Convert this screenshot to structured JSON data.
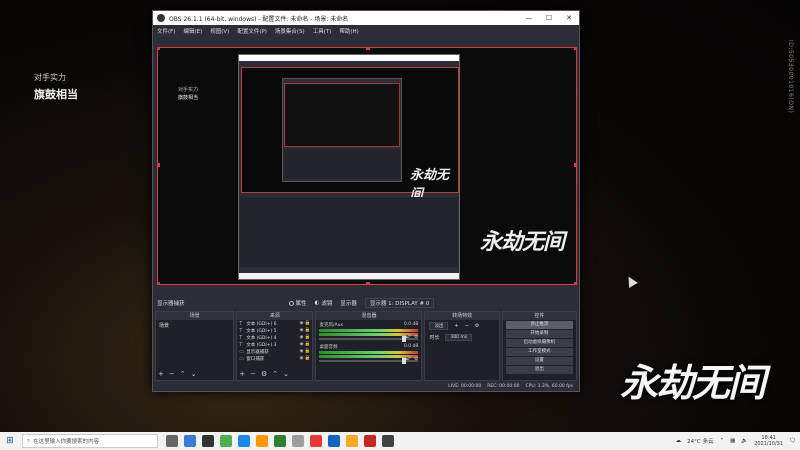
{
  "overlay": {
    "opponent_label": "对手实力",
    "opponent_value": "旗鼓相当",
    "side_id": "ID:50530001016(ON)",
    "logo": "永劫无间"
  },
  "obs": {
    "title": "OBS 26.1.1 (64-bit, windows) - 配置文件: 未命名 - 场景: 未命名",
    "menus": [
      "文件(F)",
      "编辑(E)",
      "视图(V)",
      "配置文件(P)",
      "场景集合(S)",
      "工具(T)",
      "帮助(H)"
    ],
    "preview_text1": "对手实力",
    "preview_text2": "旗鼓相当",
    "scene_selector": "显示器捕获",
    "scenebar_items": [
      "属性",
      "滤镜",
      "显示器",
      "显示器 1: DISPLAY # 0"
    ],
    "docks": {
      "scenes": {
        "title": "场景",
        "items": [
          "场景"
        ]
      },
      "sources": {
        "title": "来源",
        "items": [
          {
            "icon": "T",
            "label": "文本 (GDI+) 6"
          },
          {
            "icon": "T",
            "label": "文本 (GDI+) 5"
          },
          {
            "icon": "T",
            "label": "文本 (GDI+) 4"
          },
          {
            "icon": "T",
            "label": "文本 (GDI+) 3"
          },
          {
            "icon": "▭",
            "label": "显示器捕获"
          },
          {
            "icon": "▭",
            "label": "窗口捕获"
          }
        ]
      },
      "mixer": {
        "title": "混音器",
        "channels": [
          {
            "name": "麦克风/Aux",
            "db": "0.0 dB"
          },
          {
            "name": "桌面音频",
            "db": "0.0 dB"
          }
        ]
      },
      "transitions": {
        "title": "转场特效",
        "type": "淡出",
        "duration_label": "时长",
        "duration": "300 ms"
      },
      "controls": {
        "title": "控件",
        "buttons": [
          "停止推流",
          "开始录制",
          "启动虚拟摄像机",
          "工作室模式",
          "设置",
          "退出"
        ]
      }
    },
    "status": [
      "LIVE: 00:00:00",
      "REC: 00:00:00",
      "CPU: 1.3%, 60.00 fps"
    ]
  },
  "taskbar": {
    "search_placeholder": "在这里输入你要搜索的内容",
    "weather": "24°C 多云",
    "time": "18:41",
    "date": "2021/10/31",
    "icons": [
      "#666",
      "#3a7bd5",
      "#333",
      "#4caf50",
      "#1e88e5",
      "#ff9800",
      "#2e7d32",
      "#9e9e9e",
      "#e53935",
      "#1565c0",
      "#f9a825",
      "#c62828",
      "#424242"
    ]
  }
}
